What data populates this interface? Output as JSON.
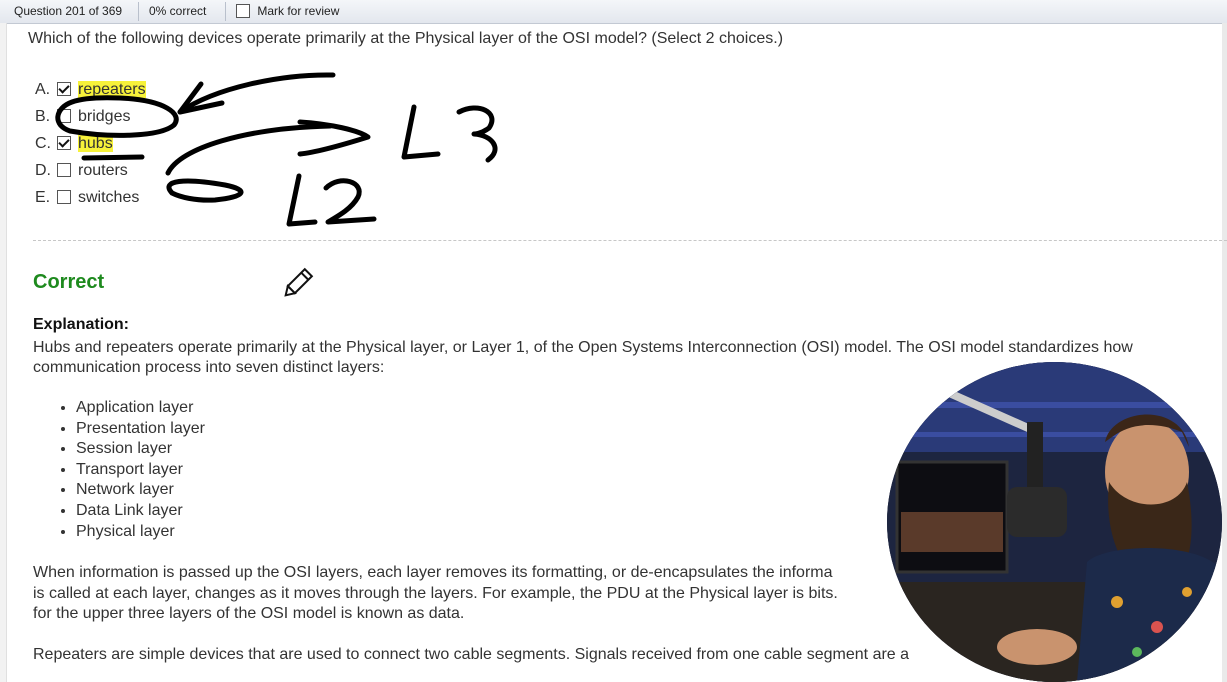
{
  "header": {
    "question_counter": "Question 201 of 369",
    "score": "0% correct",
    "mark_review_label": "Mark for review"
  },
  "question": {
    "text": "Which of the following devices operate primarily at the Physical layer of the OSI model?  (Select 2 choices.)"
  },
  "choices": [
    {
      "letter": "A.",
      "label": "repeaters",
      "checked": true,
      "highlighted": true
    },
    {
      "letter": "B.",
      "label": "bridges",
      "checked": false,
      "highlighted": false
    },
    {
      "letter": "C.",
      "label": "hubs",
      "checked": true,
      "highlighted": true
    },
    {
      "letter": "D.",
      "label": "routers",
      "checked": false,
      "highlighted": false
    },
    {
      "letter": "E.",
      "label": "switches",
      "checked": false,
      "highlighted": false
    }
  ],
  "annotations": {
    "label_l3": "L3",
    "label_l2": "L2"
  },
  "result": {
    "label": "Correct",
    "color": "#1e8a1e"
  },
  "explanation": {
    "heading": "Explanation:",
    "para1_line1": "Hubs and repeaters operate primarily at the Physical layer, or Layer 1, of the Open Systems Interconnection (OSI) model. The OSI model standardizes how",
    "para1_line2": "communication process into seven distinct layers:",
    "layers": [
      "Application layer",
      "Presentation layer",
      "Session layer",
      "Transport layer",
      "Network layer",
      "Data Link layer",
      "Physical layer"
    ],
    "para2_line1": "When information is passed up the OSI layers, each layer removes its formatting, or de-encapsulates the informa",
    "para2_line2": "is called at each layer, changes as it moves through the layers. For example, the PDU at the Physical layer is bits.",
    "para2_line3": "for the upper three layers of the OSI model is known as data.",
    "para3_line1": "Repeaters are simple devices that are used to connect two cable segments. Signals received from one cable segment are a"
  },
  "colors": {
    "highlight": "#f7f23a",
    "correct": "#1e8a1e",
    "ink": "#000000"
  }
}
